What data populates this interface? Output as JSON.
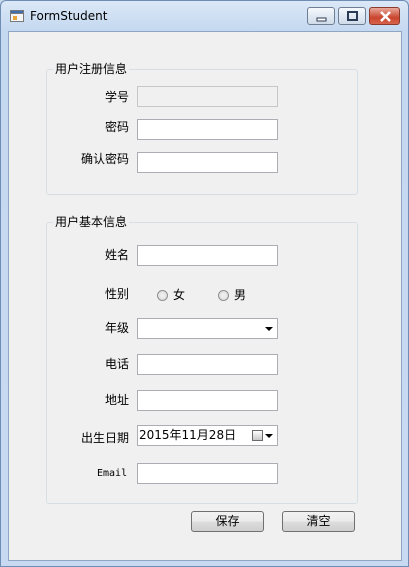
{
  "window": {
    "title": "FormStudent"
  },
  "register_group": {
    "title": "用户注册信息",
    "student_id_label": "学号",
    "student_id_value": "",
    "password_label": "密码",
    "password_value": "",
    "confirm_label": "确认密码",
    "confirm_value": ""
  },
  "basic_group": {
    "title": "用户基本信息",
    "name_label": "姓名",
    "name_value": "",
    "gender_label": "性别",
    "gender_female": "女",
    "gender_male": "男",
    "grade_label": "年级",
    "grade_value": "",
    "phone_label": "电话",
    "phone_value": "",
    "address_label": "地址",
    "address_value": "",
    "birth_label": "出生日期",
    "birth_value": "2015年11月28日",
    "email_label": "Email",
    "email_value": ""
  },
  "buttons": {
    "save": "保存",
    "clear": "清空"
  },
  "icons": {
    "app": "app-form-icon",
    "calendar": "calendar-icon"
  }
}
